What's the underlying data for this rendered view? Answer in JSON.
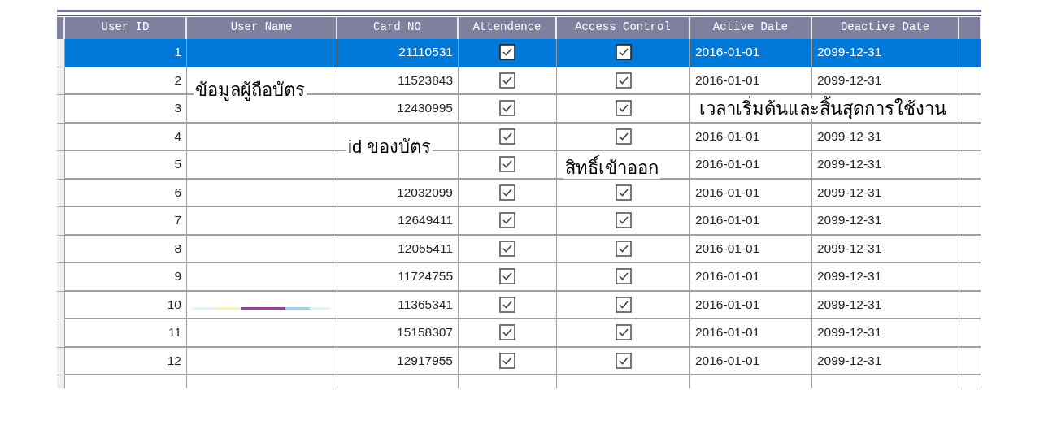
{
  "table": {
    "columns": [
      "User ID",
      "User Name",
      "Card NO",
      "Attendence",
      "Access Control",
      "Active Date",
      "Deactive Date"
    ],
    "rows": [
      {
        "user_id": "1",
        "card_no": "21110531",
        "attendence": true,
        "access_control": true,
        "active_date": "2016-01-01",
        "deactive_date": "2099-12-31",
        "selected": true
      },
      {
        "user_id": "2",
        "card_no": "11523843",
        "attendence": true,
        "access_control": true,
        "active_date": "2016-01-01",
        "deactive_date": "2099-12-31",
        "selected": false
      },
      {
        "user_id": "3",
        "card_no": "12430995",
        "attendence": true,
        "access_control": true,
        "selected": false
      },
      {
        "user_id": "4",
        "attendence": true,
        "access_control": true,
        "active_date": "2016-01-01",
        "deactive_date": "2099-12-31",
        "selected": false
      },
      {
        "user_id": "5",
        "attendence": true,
        "active_date": "2016-01-01",
        "deactive_date": "2099-12-31",
        "selected": false
      },
      {
        "user_id": "6",
        "card_no": "12032099",
        "attendence": true,
        "access_control": true,
        "active_date": "2016-01-01",
        "deactive_date": "2099-12-31",
        "selected": false
      },
      {
        "user_id": "7",
        "card_no": "12649411",
        "attendence": true,
        "access_control": true,
        "active_date": "2016-01-01",
        "deactive_date": "2099-12-31",
        "selected": false
      },
      {
        "user_id": "8",
        "card_no": "12055411",
        "attendence": true,
        "access_control": true,
        "active_date": "2016-01-01",
        "deactive_date": "2099-12-31",
        "selected": false
      },
      {
        "user_id": "9",
        "card_no": "11724755",
        "attendence": true,
        "access_control": true,
        "active_date": "2016-01-01",
        "deactive_date": "2099-12-31",
        "selected": false
      },
      {
        "user_id": "10",
        "card_no": "11365341",
        "attendence": true,
        "access_control": true,
        "active_date": "2016-01-01",
        "deactive_date": "2099-12-31",
        "selected": false
      },
      {
        "user_id": "11",
        "card_no": "15158307",
        "attendence": true,
        "access_control": true,
        "active_date": "2016-01-01",
        "deactive_date": "2099-12-31",
        "selected": false
      },
      {
        "user_id": "12",
        "card_no": "12917955",
        "attendence": true,
        "access_control": true,
        "active_date": "2016-01-01",
        "deactive_date": "2099-12-31",
        "selected": false
      },
      {
        "selected": false
      }
    ]
  },
  "annotations": [
    {
      "text": "ข้อมูลผู้ถือบัตร"
    },
    {
      "text": "id ของบัตร"
    },
    {
      "text": "สิทธิ์เข้าออก"
    },
    {
      "text": "เวลาเริ่มต้นและสิ้นสุดการใช้งาน"
    }
  ]
}
